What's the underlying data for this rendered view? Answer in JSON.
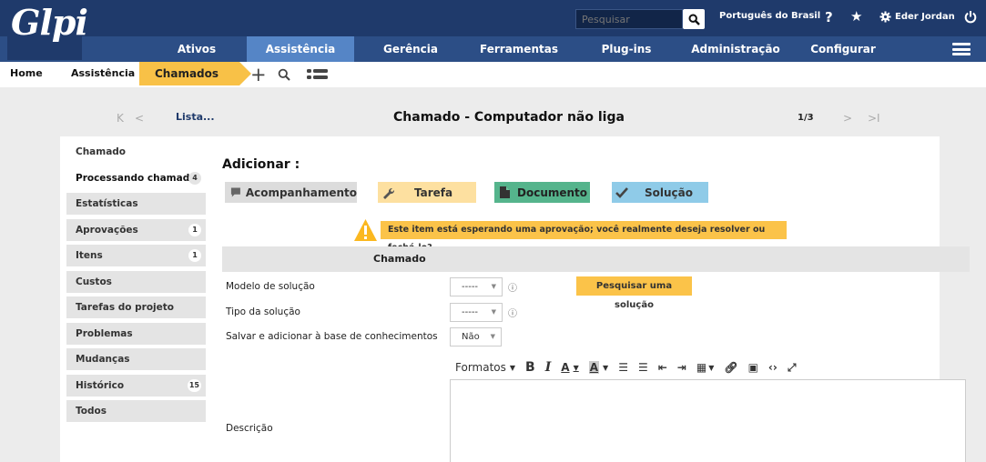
{
  "app": {
    "logo_text": "Glpi"
  },
  "topbar": {
    "search_placeholder": "Pesquisar",
    "language": "Português do Brasil",
    "help_symbol": "?",
    "user_name": "Eder Jordan"
  },
  "menu": [
    {
      "label": "Ativos"
    },
    {
      "label": "Assistência"
    },
    {
      "label": "Gerência"
    },
    {
      "label": "Ferramentas"
    },
    {
      "label": "Plug-ins"
    },
    {
      "label": "Administração"
    },
    {
      "label": "Configurar"
    }
  ],
  "breadcrumb": {
    "home": "Home",
    "section": "Assistência",
    "current": "Chamados"
  },
  "header": {
    "nav_first": "K",
    "nav_prev": "<",
    "list_link": "Lista...",
    "title": "Chamado - Computador não liga",
    "pager": "1/3",
    "nav_next": ">",
    "nav_last": ">I"
  },
  "tabs": [
    {
      "label": "Chamado",
      "badge": ""
    },
    {
      "label": "Processando chamado",
      "badge": "4"
    },
    {
      "label": "Estatísticas",
      "badge": ""
    },
    {
      "label": "Aprovações",
      "badge": "1"
    },
    {
      "label": "Itens",
      "badge": "1"
    },
    {
      "label": "Custos",
      "badge": ""
    },
    {
      "label": "Tarefas do projeto",
      "badge": ""
    },
    {
      "label": "Problemas",
      "badge": ""
    },
    {
      "label": "Mudanças",
      "badge": ""
    },
    {
      "label": "Histórico",
      "badge": "15"
    },
    {
      "label": "Todos",
      "badge": ""
    }
  ],
  "add": {
    "title": "Adicionar :",
    "followup": "Acompanhamento",
    "task": "Tarefa",
    "document": "Documento",
    "solution": "Solução"
  },
  "warning": "Este item está esperando uma aprovação; você realmente deseja resolver ou fechá-lo?",
  "form": {
    "section_title": "Chamado",
    "template_label": "Modelo de solução",
    "template_value": "-----",
    "type_label": "Tipo da solução",
    "type_value": "-----",
    "kb_label": "Salvar e adicionar à base de conhecimentos",
    "kb_value": "Não",
    "search_solution": "Pesquisar uma solução",
    "description_label": "Descrição",
    "formats_label": "Formatos"
  },
  "colors": {
    "topbar": "#1f3a6b",
    "menubar": "#2c4e86",
    "menu_active": "#5585c6",
    "accent_yellow": "#fbc349",
    "followup_bg": "#dcdcdc",
    "task_bg": "#fde0a0",
    "document_bg": "#55b48c",
    "solution_bg": "#8fcbe8"
  }
}
